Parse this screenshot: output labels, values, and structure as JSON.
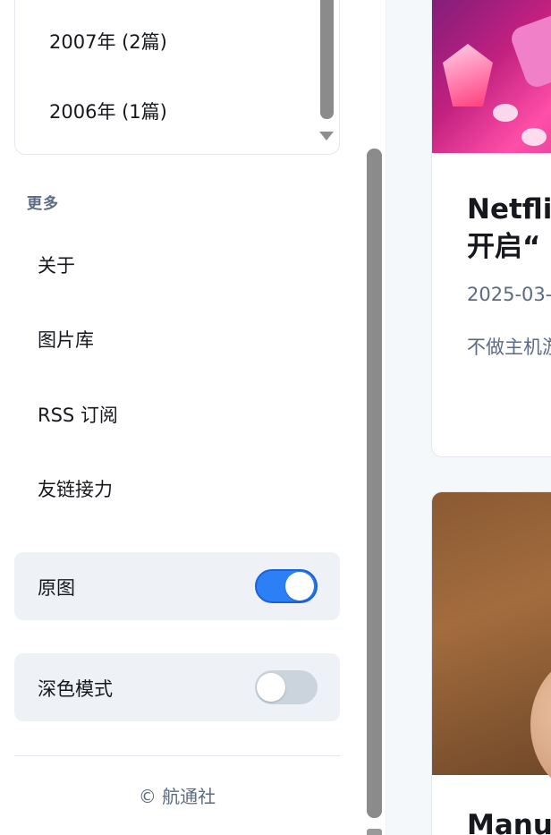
{
  "archive": {
    "items": [
      {
        "label": "2007年 (2篇)"
      },
      {
        "label": "2006年 (1篇)"
      }
    ]
  },
  "more_section": {
    "heading": "更多",
    "items": [
      {
        "label": "关于"
      },
      {
        "label": "图片库"
      },
      {
        "label": "RSS 订阅"
      },
      {
        "label": "友链接力"
      }
    ]
  },
  "toggles": [
    {
      "label": "原图",
      "state": "on"
    },
    {
      "label": "深色模式",
      "state": "off"
    }
  ],
  "footer": {
    "copyright": "© 航通社"
  },
  "posts": [
    {
      "title_line1": "Netflix",
      "title_line2": "开启“",
      "date": "2025-03-",
      "excerpt": "不做主机游"
    },
    {
      "title": "Manus"
    }
  ],
  "colors": {
    "accent": "#2d7ff5",
    "muted_text": "#5d6b82",
    "card_bg": "#eef2f6"
  }
}
